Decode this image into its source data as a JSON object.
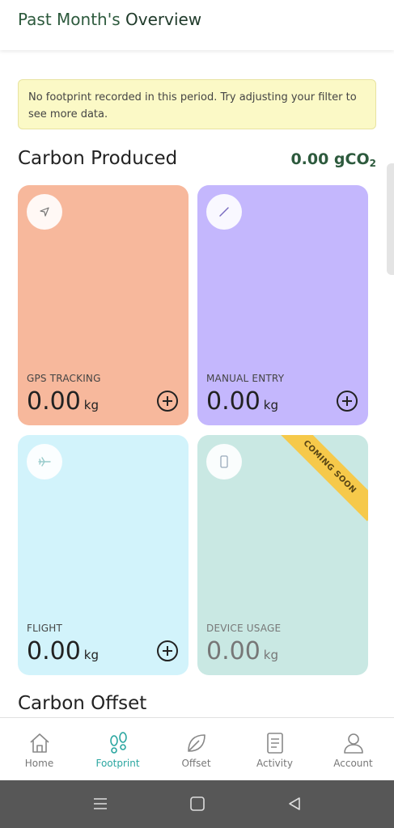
{
  "header": {
    "title_part1": "Past Month's",
    "title_part2": "Overview"
  },
  "notice": {
    "text": "No footprint recorded in this period. Try adjusting your filter to see more data."
  },
  "carbon_produced": {
    "title": "Carbon Produced",
    "total_value": "0.00 gCO",
    "total_subscript": "2"
  },
  "cards": [
    {
      "label": "GPS TRACKING",
      "value": "0.00",
      "unit": "kg",
      "icon": "navigation-arrow-icon",
      "color": "#f7b89c"
    },
    {
      "label": "MANUAL ENTRY",
      "value": "0.00",
      "unit": "kg",
      "icon": "pencil-icon",
      "color": "#c4b7fd"
    },
    {
      "label": "FLIGHT",
      "value": "0.00",
      "unit": "kg",
      "icon": "airplane-icon",
      "color": "#d2f3fb"
    },
    {
      "label": "DEVICE USAGE",
      "value": "0.00",
      "unit": "kg",
      "icon": "phone-icon",
      "color": "#c9e8e3",
      "ribbon": "COMING SOON"
    }
  ],
  "carbon_offset": {
    "title": "Carbon Offset"
  },
  "bottom_nav": [
    {
      "label": "Home",
      "icon": "home-icon"
    },
    {
      "label": "Footprint",
      "icon": "footprint-icon",
      "active": true
    },
    {
      "label": "Offset",
      "icon": "leaf-icon"
    },
    {
      "label": "Activity",
      "icon": "document-icon"
    },
    {
      "label": "Account",
      "icon": "person-icon"
    }
  ],
  "colors": {
    "accent": "#2aa6a0",
    "brand_green": "#2d5a3d",
    "ribbon": "#f6c94a"
  }
}
